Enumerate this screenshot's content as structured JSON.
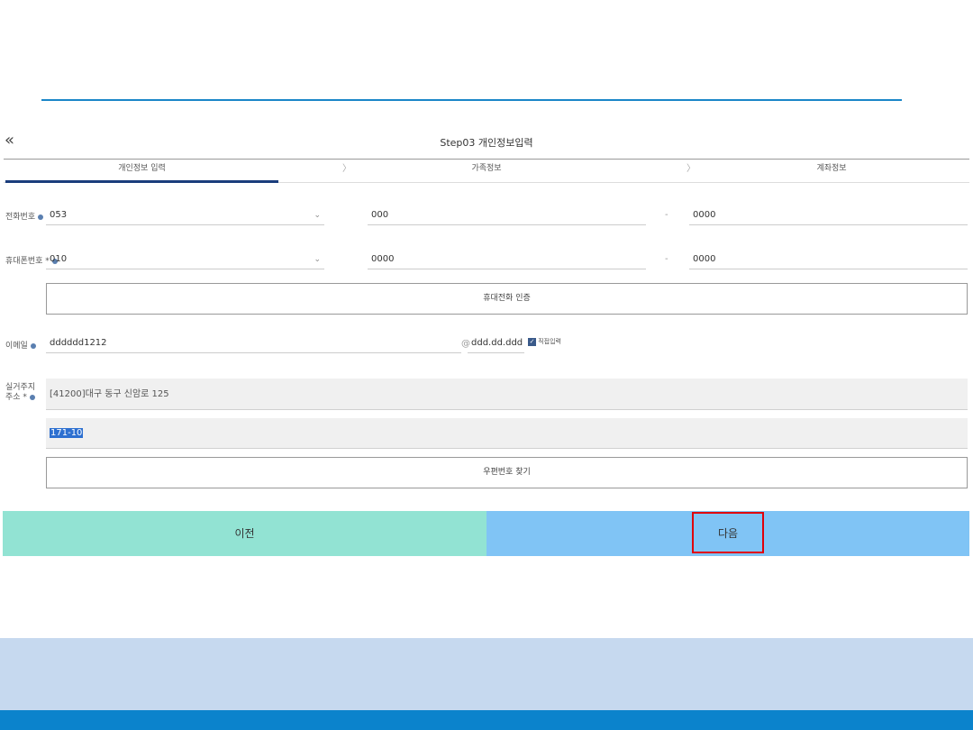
{
  "header": {
    "back_icon": "double-chevron-left-icon",
    "step_title": "Step03 개인정보입력"
  },
  "tabs": [
    {
      "label": "개인정보 입력",
      "active": true
    },
    {
      "label": "가족정보",
      "active": false
    },
    {
      "label": "계좌정보",
      "active": false
    }
  ],
  "phone": {
    "label": "전화번호",
    "area": "053",
    "mid": "000",
    "last": "0000"
  },
  "mobile": {
    "label": "휴대폰번호 *",
    "prefix": "010",
    "mid": "0000",
    "last": "0000",
    "verify_button": "휴대전화 인증"
  },
  "email": {
    "label": "이메일",
    "local": "dddddd1212",
    "at": "@",
    "domain": "ddd.dd.ddd",
    "direct_input_label": "직접입력",
    "direct_input_checked": true
  },
  "address": {
    "label": "실거주지주소 *",
    "line1": "[41200]대구 동구 신암로 125",
    "line2": "171-10",
    "postcode_button": "우편번호 찾기"
  },
  "nav": {
    "prev": "이전",
    "next": "다음"
  },
  "separators": {
    "tab_sep": "〉",
    "dash": "-",
    "chevron": "⌄"
  },
  "colors": {
    "accent": "#1a86c8",
    "prev_bg": "#92e3d3",
    "next_bg": "#80c4f5",
    "highlight": "#e0000a",
    "footer": "#0b83cc"
  }
}
